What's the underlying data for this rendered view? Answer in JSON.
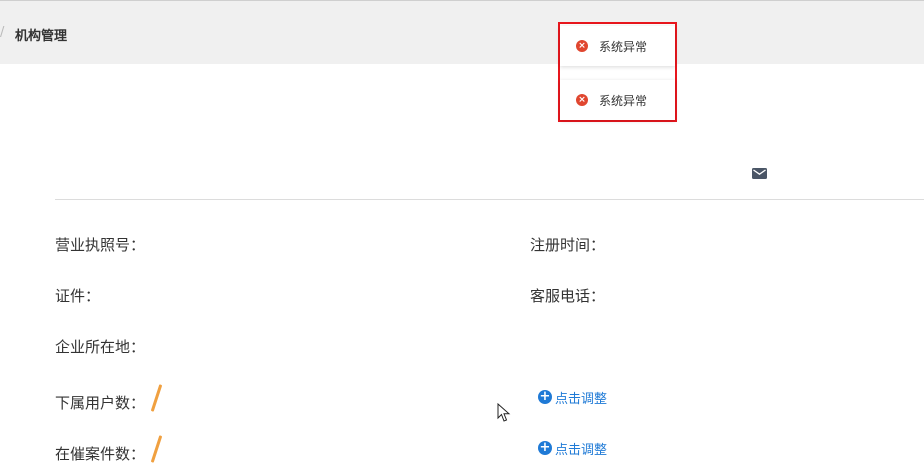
{
  "header": {
    "breadcrumb": "机构管理"
  },
  "toasts": [
    {
      "icon": "error-icon",
      "message": "系统异常",
      "color": "#e0462f"
    },
    {
      "icon": "error-icon",
      "message": "系统异常",
      "color": "#e0462f"
    }
  ],
  "fields": {
    "license_label": "营业执照号：",
    "reg_time_label": "注册时间：",
    "cert_label": "证件：",
    "service_phone_label": "客服电话：",
    "location_label": "企业所在地：",
    "sub_users_label": "下属用户数：",
    "cases_label": "在催案件数："
  },
  "actions": {
    "adjust_label_1": "点击调整",
    "adjust_label_2": "点击调整"
  },
  "colors": {
    "link": "#1f7ad6",
    "error": "#e0462f",
    "highlight_border": "#e8161d",
    "accent": "#f0a040"
  }
}
